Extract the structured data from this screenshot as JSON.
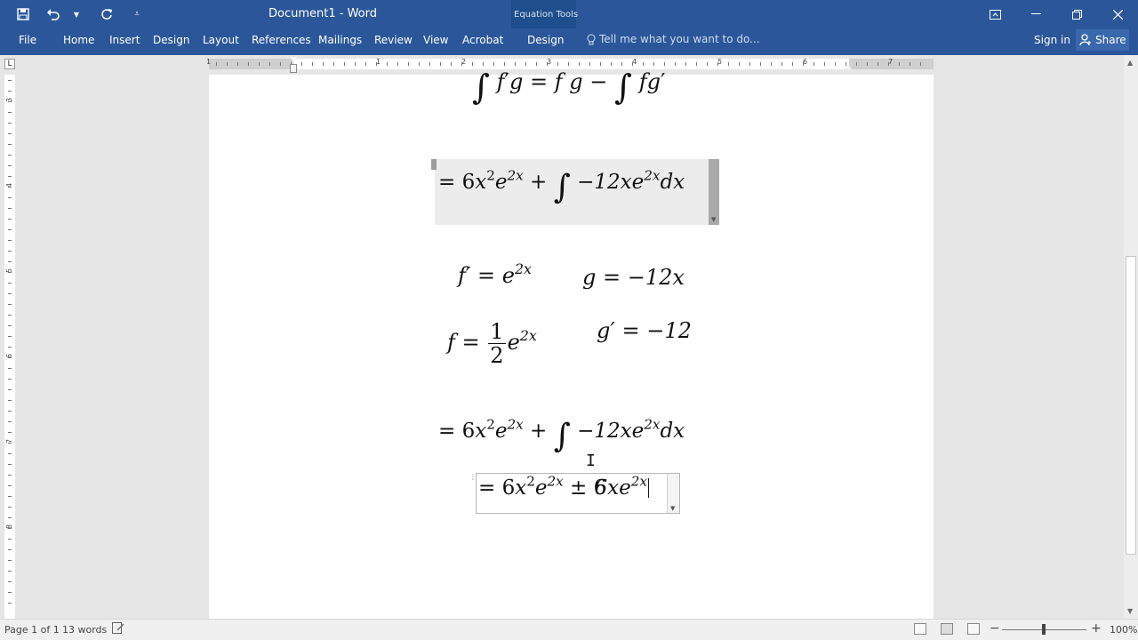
{
  "app": {
    "window_title": "Document1 - Word",
    "context_group": "Equation Tools"
  },
  "quick_access": {
    "save_icon": "save-icon",
    "undo_icon": "undo-icon",
    "redo_icon": "redo-icon",
    "customize_icon": "customize-qat-icon"
  },
  "ribbon": {
    "tabs": [
      "File",
      "Home",
      "Insert",
      "Design",
      "Layout",
      "References",
      "Mailings",
      "Review",
      "View",
      "Acrobat",
      "Design"
    ],
    "tell_me": "Tell me what you want to do...",
    "sign_in": "Sign in",
    "share": "Share"
  },
  "ruler": {
    "h_numbers": [
      "1",
      "1",
      "2",
      "3",
      "4",
      "5",
      "6",
      "7"
    ],
    "v_numbers": [
      "3",
      "4",
      "5",
      "6",
      "7",
      "8"
    ],
    "tab_selector": "L"
  },
  "document": {
    "eq_top": {
      "lhs_f": "f",
      "lhs_g": "g",
      "rhs_fg": "f g",
      "minus": "−",
      "rhs_f": "f",
      "rhs_g": "g"
    },
    "eq_one": {
      "eq": "=",
      "coef": "6",
      "x": "x",
      "exp1": "2",
      "e": "e",
      "exp2": "2x",
      "plus": "+",
      "integrand": "−12xe",
      "exp3": "2x",
      "dx": "dx"
    },
    "f_prime": {
      "f": "f′",
      "eq": "=",
      "e": "e",
      "exp": "2x"
    },
    "g_val": {
      "g": "g",
      "eq": "=",
      "val": "−12x"
    },
    "f_val": {
      "f": "f",
      "eq": "=",
      "num": "1",
      "den": "2",
      "e": "e",
      "exp": "2x"
    },
    "g_prime": {
      "g": "g′",
      "eq": "=",
      "val": "−12"
    },
    "eq_two": {
      "eq": "=",
      "coef": "6",
      "x": "x",
      "exp1": "2",
      "e": "e",
      "exp2": "2x",
      "plus": "+",
      "integrand": "−12xe",
      "exp3": "2x",
      "dx": "dx"
    },
    "eq_three": {
      "eq": "=",
      "coef": "6",
      "x": "x",
      "exp1": "2",
      "e": "e",
      "exp2": "2x",
      "pm": "±",
      "term": "6xe",
      "exp3": "2x"
    }
  },
  "status": {
    "page": "Page 1 of 1",
    "words": "13 words",
    "zoom_minus": "−",
    "zoom_plus": "+",
    "zoom": "100%"
  }
}
